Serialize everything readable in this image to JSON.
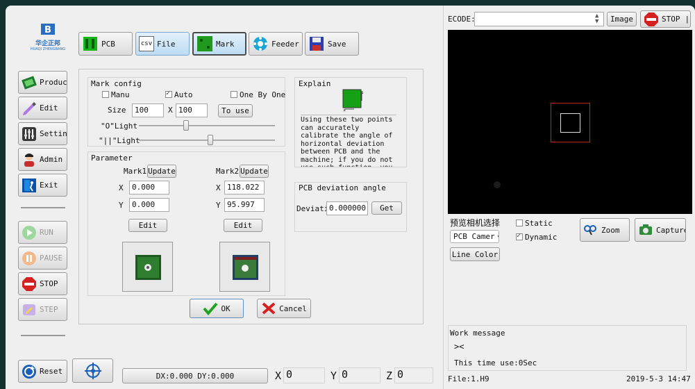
{
  "brand": {
    "name": "华企正邦",
    "sub": "HUAQI ZHENGBANG"
  },
  "toolbar": {
    "pcb": "PCB",
    "file": "File",
    "mark": "Mark",
    "feeder": "Feeder",
    "save": "Save",
    "csv": "csv"
  },
  "sidebar": {
    "product": "Product",
    "edit": "Edit",
    "setting": "Setting",
    "admin": "Admin",
    "exit": "Exit",
    "run": "RUN",
    "pause": "PAUSE",
    "stop": "STOP",
    "step": "STEP"
  },
  "mark_config": {
    "title": "Mark config",
    "manu": "Manu",
    "auto": "Auto",
    "one_by_one": "One By One",
    "manu_checked": false,
    "auto_checked": true,
    "one_by_one_checked": false,
    "size_label": "Size",
    "size_w": "100",
    "x_label": "X",
    "size_h": "100",
    "to_use": "To use",
    "light0_label": "\"O\"Light",
    "light1_label": "\"||\"Light",
    "light0_level": 0.5,
    "light1_level": 0.68
  },
  "explain": {
    "title": "Explain",
    "text": "Using these two points can accurately calibrate the angle of horizontal deviation between PCB and the machine; if you do not use such function, you"
  },
  "parameter": {
    "title": "Parameter",
    "mark1": {
      "label": "Mark1",
      "update": "Update",
      "x_label": "X",
      "x": "0.000",
      "y_label": "Y",
      "y": "0.000",
      "edit": "Edit"
    },
    "mark2": {
      "label": "Mark2",
      "update": "Update",
      "x_label": "X",
      "x": "118.022",
      "y_label": "Y",
      "y": "95.997",
      "edit": "Edit"
    }
  },
  "deviation": {
    "title": "PCB deviation angle",
    "label": "Deviati",
    "value": "0.000000",
    "get": "Get"
  },
  "dialog": {
    "ok": "OK",
    "cancel": "Cancel"
  },
  "bottom": {
    "reset": "Reset",
    "dxdy": "DX:0.000 DY:0.000",
    "x_label": "X",
    "x_val": "0",
    "y_label": "Y",
    "y_val": "0",
    "z_label": "Z",
    "z_val": "0"
  },
  "camera": {
    "ecode_label": "ECODE:",
    "ecode_value": "",
    "image": "Image",
    "stop": "STOP",
    "preview_label": "预览相机选择",
    "camera_select": "PCB Camer",
    "static": "Static",
    "dynamic": "Dynamic",
    "static_checked": false,
    "dynamic_checked": true,
    "zoom": "Zoom",
    "capture": "Capture",
    "line_color": "Line Color"
  },
  "work": {
    "title": "Work message",
    "close_glyph": "><",
    "time_use": "This time use:0Sec"
  },
  "status": {
    "file": "File:1.H9",
    "datetime": "2019-5-3 14:47"
  },
  "colors": {
    "accent_green": "#1ea31e",
    "stop_red": "#d42020",
    "camera_bg": "#000000",
    "roi_red": "#cc1f1f"
  }
}
